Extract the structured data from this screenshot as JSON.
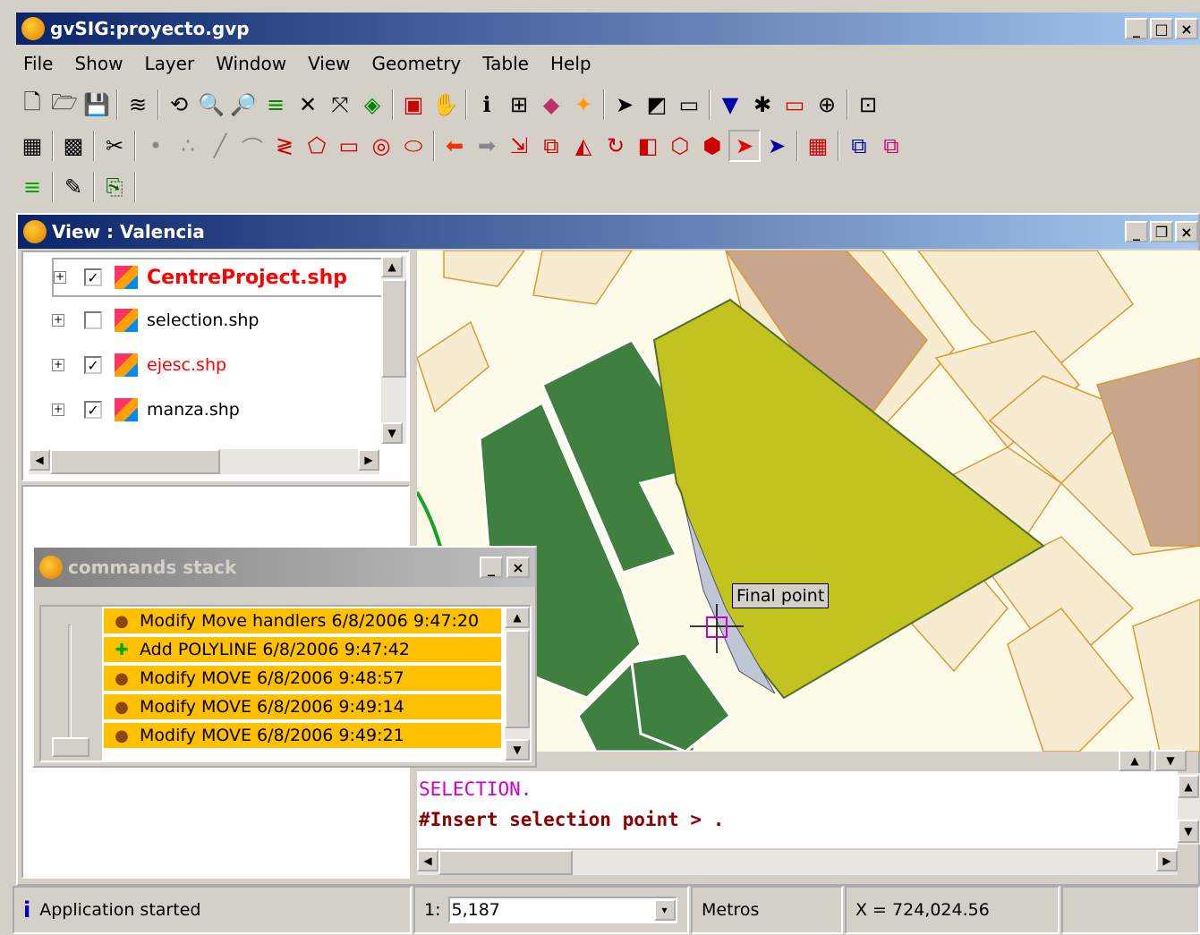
{
  "app": {
    "title": "gvSIG:proyecto.gvp"
  },
  "menu": [
    "File",
    "Show",
    "Layer",
    "Window",
    "View",
    "Geometry",
    "Table",
    "Help"
  ],
  "view": {
    "title": "View : Valencia"
  },
  "toc": {
    "layers": [
      {
        "name": "CentreProject.shp",
        "checked": true,
        "color": "#ff0000"
      },
      {
        "name": "selection.shp",
        "checked": false,
        "color": "#000000"
      },
      {
        "name": "ejesc.shp",
        "checked": true,
        "color": "#ff0000"
      },
      {
        "name": "manza.shp",
        "checked": true,
        "color": "#000000"
      }
    ]
  },
  "commands": {
    "title": "commands stack",
    "items": [
      {
        "icon": "move-dot-icon",
        "text": "Modify Move handlers 6/8/2006 9:47:20"
      },
      {
        "icon": "add-plus-icon",
        "text": "Add POLYLINE 6/8/2006 9:47:42"
      },
      {
        "icon": "move-dot-icon",
        "text": "Modify MOVE 6/8/2006 9:48:57"
      },
      {
        "icon": "move-dot-icon",
        "text": "Modify MOVE 6/8/2006 9:49:14"
      },
      {
        "icon": "move-dot-icon",
        "text": "Modify MOVE 6/8/2006 9:49:21"
      }
    ]
  },
  "map": {
    "tooltip": "Final point"
  },
  "console": {
    "line1": "SELECTION.",
    "line2": "#Insert selection point > ."
  },
  "status": {
    "message": "Application started",
    "scale_prefix": "1:",
    "scale": "5,187",
    "units": "Metros",
    "x_coord": "X = 724,024.56"
  }
}
